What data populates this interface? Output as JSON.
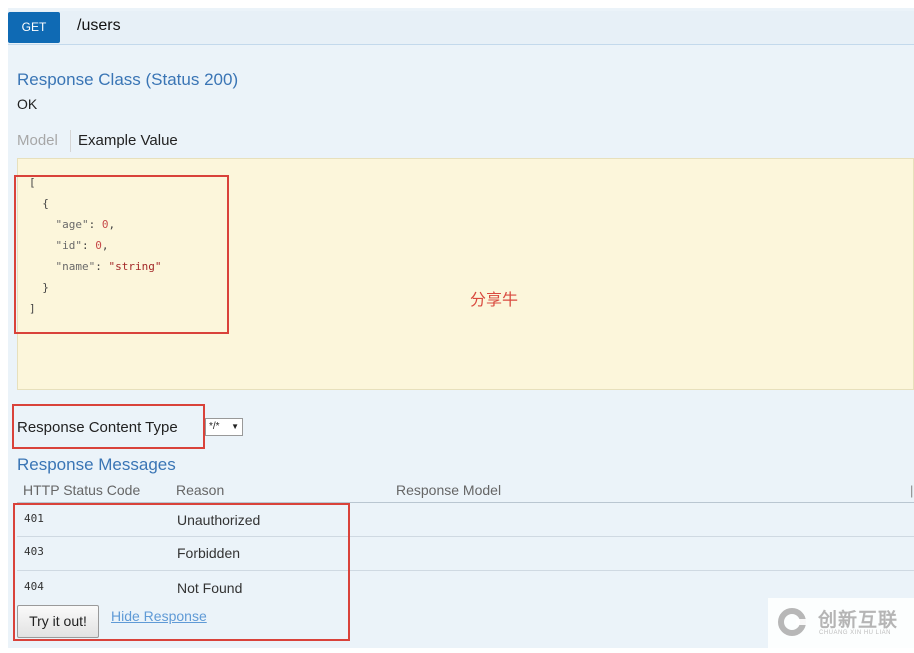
{
  "operation": {
    "method": "GET",
    "path": "/users"
  },
  "response_class": {
    "title": "Response Class (Status 200)",
    "status_text": "OK"
  },
  "model_tabs": {
    "model": "Model",
    "example": "Example Value"
  },
  "example_json": {
    "l1": "[",
    "l2": "  {",
    "k_age": "\"age\"",
    "v_age": "0",
    "k_id": "\"id\"",
    "v_id": "0",
    "k_name": "\"name\"",
    "v_name": "\"string\"",
    "l6": "  }",
    "l7": "]"
  },
  "watermark_center": "分享牛",
  "response_content_type": {
    "label": "Response Content Type",
    "selected": "*/*"
  },
  "response_messages": {
    "title": "Response Messages",
    "headers": [
      "HTTP Status Code",
      "Reason",
      "Response Model"
    ],
    "rows": [
      {
        "code": "401",
        "reason": "Unauthorized"
      },
      {
        "code": "403",
        "reason": "Forbidden"
      },
      {
        "code": "404",
        "reason": "Not Found"
      }
    ]
  },
  "actions": {
    "try_label": "Try it out!",
    "hide_label": "Hide Response"
  },
  "logo": {
    "name": "创新互联",
    "sub": "CHUANG XIN HU LIAN"
  },
  "colors": {
    "method_bg": "#0f6ab4",
    "link": "#3a75b5",
    "highlight": "#d9423a",
    "example_bg": "#fcf6db"
  }
}
